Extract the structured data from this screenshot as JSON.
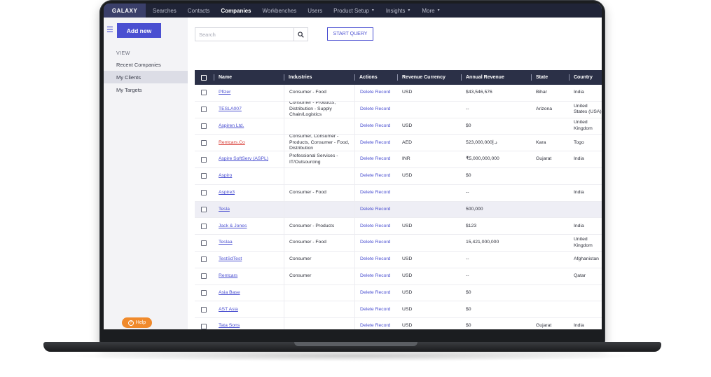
{
  "nav": {
    "logo": "GALAXY",
    "items": [
      {
        "label": "Searches",
        "active": false,
        "dropdown": false
      },
      {
        "label": "Contacts",
        "active": false,
        "dropdown": false
      },
      {
        "label": "Companies",
        "active": true,
        "dropdown": false
      },
      {
        "label": "Workbenches",
        "active": false,
        "dropdown": false
      },
      {
        "label": "Users",
        "active": false,
        "dropdown": false
      },
      {
        "label": "Product Setup",
        "active": false,
        "dropdown": true
      },
      {
        "label": "Insights",
        "active": false,
        "dropdown": true
      },
      {
        "label": "More",
        "active": false,
        "dropdown": true
      }
    ]
  },
  "sidebar": {
    "add_new": "Add new",
    "view_label": "VIEW",
    "items": [
      {
        "label": "Recent Companies",
        "active": false
      },
      {
        "label": "My Clients",
        "active": true
      },
      {
        "label": "My Targets",
        "active": false
      }
    ],
    "help": "Help"
  },
  "search": {
    "placeholder": "Search",
    "value": ""
  },
  "start_query": "START QUERY",
  "table": {
    "headers": [
      "Name",
      "Industries",
      "Actions",
      "Revenue Currency",
      "Annual Revenue",
      "State",
      "Country"
    ],
    "rows": [
      {
        "name": "Pfizer",
        "name_color": "link",
        "industries": "Consumer - Food",
        "action": "Delete Record",
        "currency": "USD",
        "revenue": "$43,546,576",
        "state": "Bihar",
        "country": "India"
      },
      {
        "name": "TESLA007",
        "name_color": "link",
        "industries": "Consumer - Products, Distribution - Supply Chain/Logistics",
        "action": "Delete Record",
        "currency": "",
        "revenue": "--",
        "state": "Arizona",
        "country": "United States (USA)"
      },
      {
        "name": "Aspiren Ltd.",
        "name_color": "link",
        "industries": "",
        "action": "Delete Record",
        "currency": "USD",
        "revenue": "$0",
        "state": "",
        "country": "United Kingdom"
      },
      {
        "name": "Rentcars.Co",
        "name_color": "red",
        "industries": "Consumer, Consumer - Products, Consumer - Food, Distribution",
        "action": "Delete Record",
        "currency": "AED",
        "revenue": "523,000,000د.إ",
        "state": "Kara",
        "country": "Togo"
      },
      {
        "name": "Aspire SoftServ (ASPL)",
        "name_color": "link",
        "industries": "Professional Services - IT/Outsourcing",
        "action": "Delete Record",
        "currency": "INR",
        "revenue": "₹5,000,000,000",
        "state": "Gujarat",
        "country": "India"
      },
      {
        "name": "Aspiro",
        "name_color": "link",
        "industries": "",
        "action": "Delete Record",
        "currency": "USD",
        "revenue": "$0",
        "state": "",
        "country": ""
      },
      {
        "name": "Aspire3",
        "name_color": "link",
        "industries": "Consumer - Food",
        "action": "Delete Record",
        "currency": "",
        "revenue": "--",
        "state": "",
        "country": "India"
      },
      {
        "name": "Tesla",
        "name_color": "link",
        "industries": "",
        "action": "Delete Record",
        "currency": "",
        "revenue": "500,000",
        "state": "",
        "country": "",
        "highlight": true
      },
      {
        "name": "Jack & Jones",
        "name_color": "link",
        "industries": "Consumer - Products",
        "action": "Delete Record",
        "currency": "USD",
        "revenue": "$123",
        "state": "",
        "country": "India"
      },
      {
        "name": "Teslaa",
        "name_color": "link",
        "industries": "Consumer - Food",
        "action": "Delete Record",
        "currency": "",
        "revenue": "15,421,000,000",
        "state": "",
        "country": "United Kingdom"
      },
      {
        "name": "TestSdTest",
        "name_color": "link",
        "industries": "Consumer",
        "action": "Delete Record",
        "currency": "USD",
        "revenue": "--",
        "state": "",
        "country": "Afghanistan"
      },
      {
        "name": "Rentcars",
        "name_color": "link",
        "industries": "Consumer",
        "action": "Delete Record",
        "currency": "USD",
        "revenue": "--",
        "state": "",
        "country": "Qatar"
      },
      {
        "name": "Asia Base",
        "name_color": "link",
        "industries": "",
        "action": "Delete Record",
        "currency": "USD",
        "revenue": "$0",
        "state": "",
        "country": ""
      },
      {
        "name": "AST Asia",
        "name_color": "link",
        "industries": "",
        "action": "Delete Record",
        "currency": "USD",
        "revenue": "$0",
        "state": "",
        "country": ""
      },
      {
        "name": "Tata Sons",
        "name_color": "link",
        "industries": "",
        "action": "Delete Record",
        "currency": "USD",
        "revenue": "$0",
        "state": "Gujarat",
        "country": "India"
      }
    ]
  }
}
